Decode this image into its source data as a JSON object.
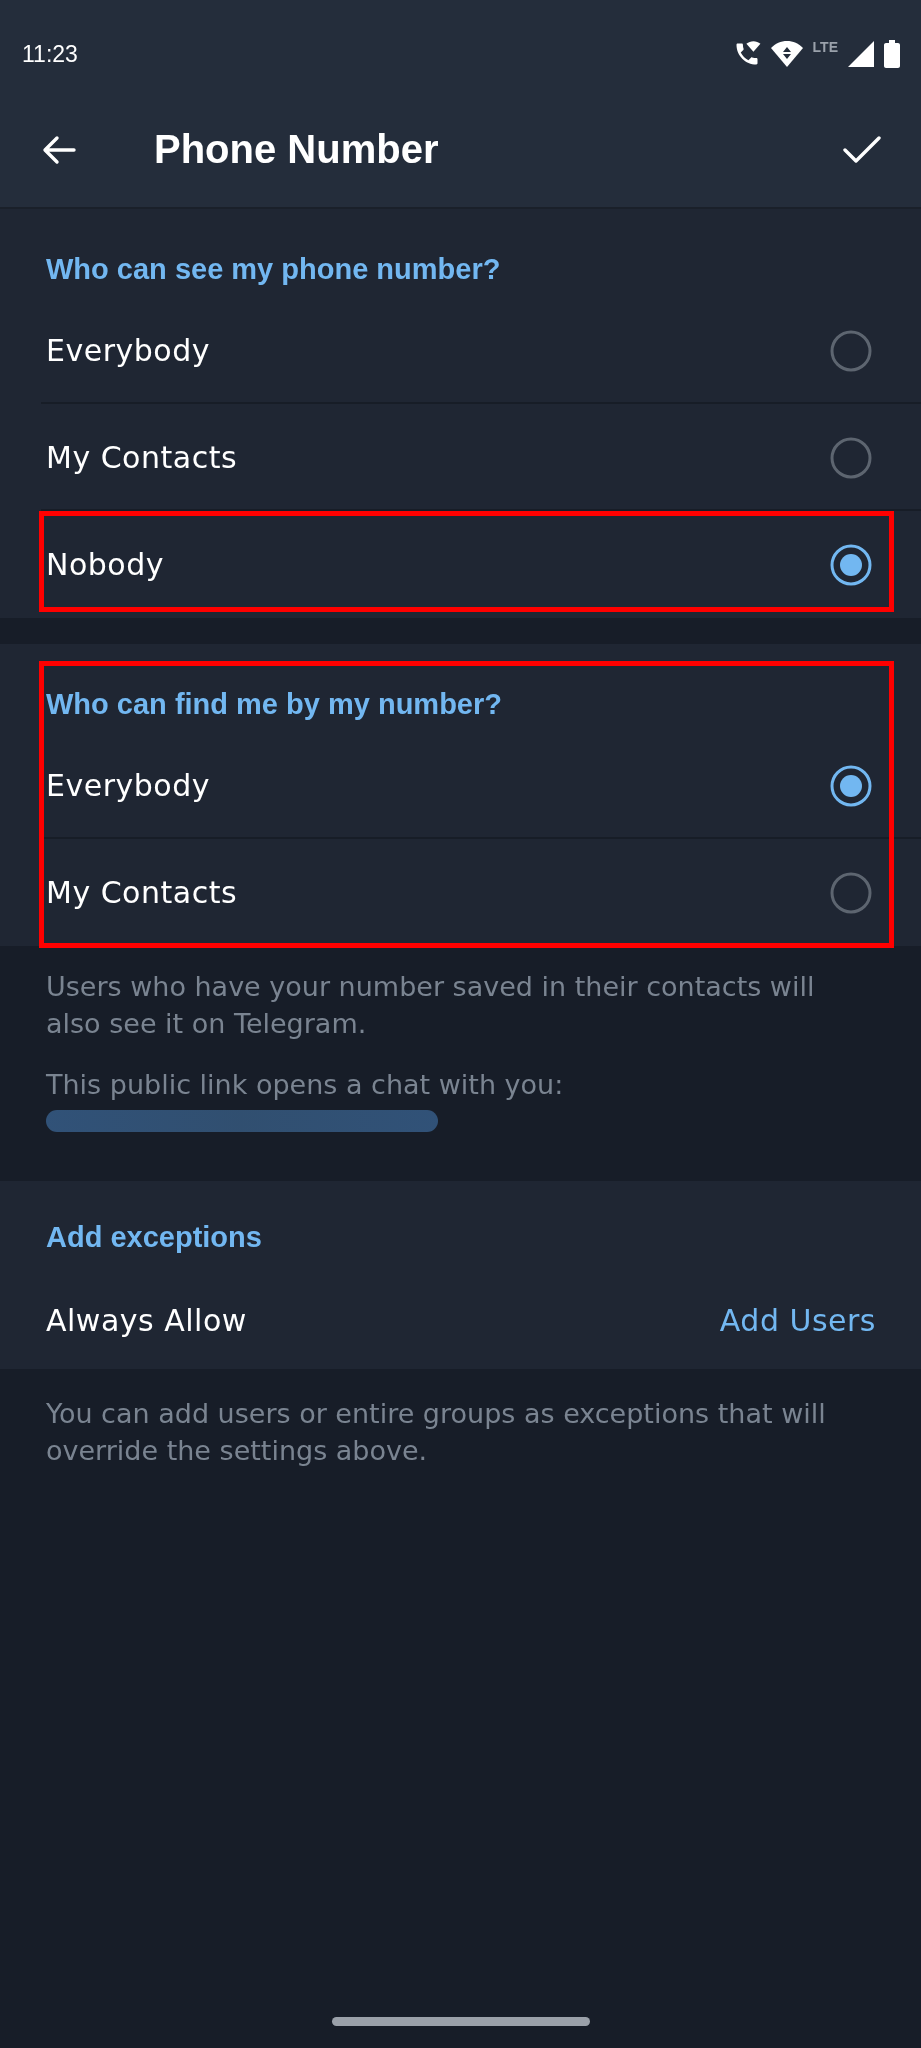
{
  "status_bar": {
    "time": "11:23",
    "network": "LTE"
  },
  "toolbar": {
    "title": "Phone Number"
  },
  "sections": [
    {
      "header": "Who can see my phone number?",
      "highlighted": false,
      "options": [
        {
          "label": "Everybody",
          "selected": false,
          "highlighted": false
        },
        {
          "label": "My Contacts",
          "selected": false,
          "highlighted": false
        },
        {
          "label": "Nobody",
          "selected": true,
          "highlighted": true
        }
      ]
    },
    {
      "header": "Who can find me by my number?",
      "highlighted": true,
      "options": [
        {
          "label": "Everybody",
          "selected": true,
          "highlighted": false
        },
        {
          "label": "My Contacts",
          "selected": false,
          "highlighted": false
        }
      ]
    }
  ],
  "info": [
    {
      "kind": "text",
      "text": "Users who have your number saved in their contacts will also see it on Telegram."
    },
    {
      "kind": "text",
      "text": "This public link opens a chat with you:"
    },
    {
      "kind": "blurred_link"
    }
  ],
  "exceptions": {
    "header": "Add exceptions",
    "rows": [
      {
        "label": "Always Allow",
        "action": "Add Users"
      }
    ]
  },
  "footer_note": "You can add users or entire groups as exceptions that will override the settings above."
}
